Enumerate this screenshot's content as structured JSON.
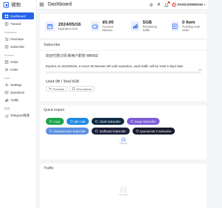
{
  "sidebar": {
    "logo_text": "微勃",
    "items_dashboard": "Dashboard",
    "items_tutorial": "Tutorial",
    "group_subscribe": "Subscribe",
    "items_purchase": "Purchase",
    "items_subscribe": "Subscribe",
    "group_finance": "Finance",
    "items_order": "Order",
    "items_invite": "Invite",
    "group_user": "User",
    "items_settings": "Settings",
    "items_questions": "Questions",
    "items_traffic": "Traffic",
    "group_other": "其他",
    "items_telegram": "Telegram频道"
  },
  "header": {
    "title": "Dashboard",
    "username": "DAVIDJONNE5254",
    "avatar_initial": "D",
    "lang_icon_text": "A"
  },
  "stats": {
    "expire_value": "2024/05/16",
    "expire_label": "Expiration time",
    "balance_value": "¥0.00",
    "balance_label": "Account balance",
    "traffic_value": "5GB",
    "traffic_label": "Remaining traffic",
    "pending_value": "0 Item",
    "pending_label": "Pending work order"
  },
  "subscribe": {
    "title": "Subscribe",
    "name": "欢迎付费订阅-新用户即尝-WBN0Z",
    "expire_text": "Expires on 2024/05/16, 5 Hours 59 Minutes left until expiration, used traffic will be reset 0 days later",
    "progress_percent": 0,
    "progress_label": "0%",
    "used_text": "Used 0B / Total 5GB",
    "purchase_label": "Purchase",
    "tutorial_label": "View tutorial"
  },
  "quick": {
    "title": "Quick import",
    "row1": [
      {
        "label": "Copy",
        "color": "#1aa34a",
        "icon": "copy-icon"
      },
      {
        "label": "QR code",
        "color": "#1e88e5",
        "icon": "qr-icon"
      },
      {
        "label": "Clash Subscribe",
        "color": "#102a43",
        "icon": "clash-icon"
      },
      {
        "label": "Surge Subscribe",
        "color": "#7c5cd6",
        "icon": "surge-icon"
      }
    ],
    "row2": [
      {
        "label": "Shadowrocket Subscribe",
        "color": "#5a8fe0",
        "icon": "shadowrocket-icon"
      },
      {
        "label": "Surfboard Subscribe",
        "color": "#1b1f3b",
        "icon": "surfboard-icon"
      },
      {
        "label": "Quantumult X Subscribe",
        "color": "#1a1a2e",
        "icon": "quantumult-icon"
      }
    ],
    "empty_label": "Others"
  },
  "traffic": {
    "title": "Traffic",
    "empty_label": "No data"
  },
  "colors": {
    "accent": "#2563eb"
  }
}
